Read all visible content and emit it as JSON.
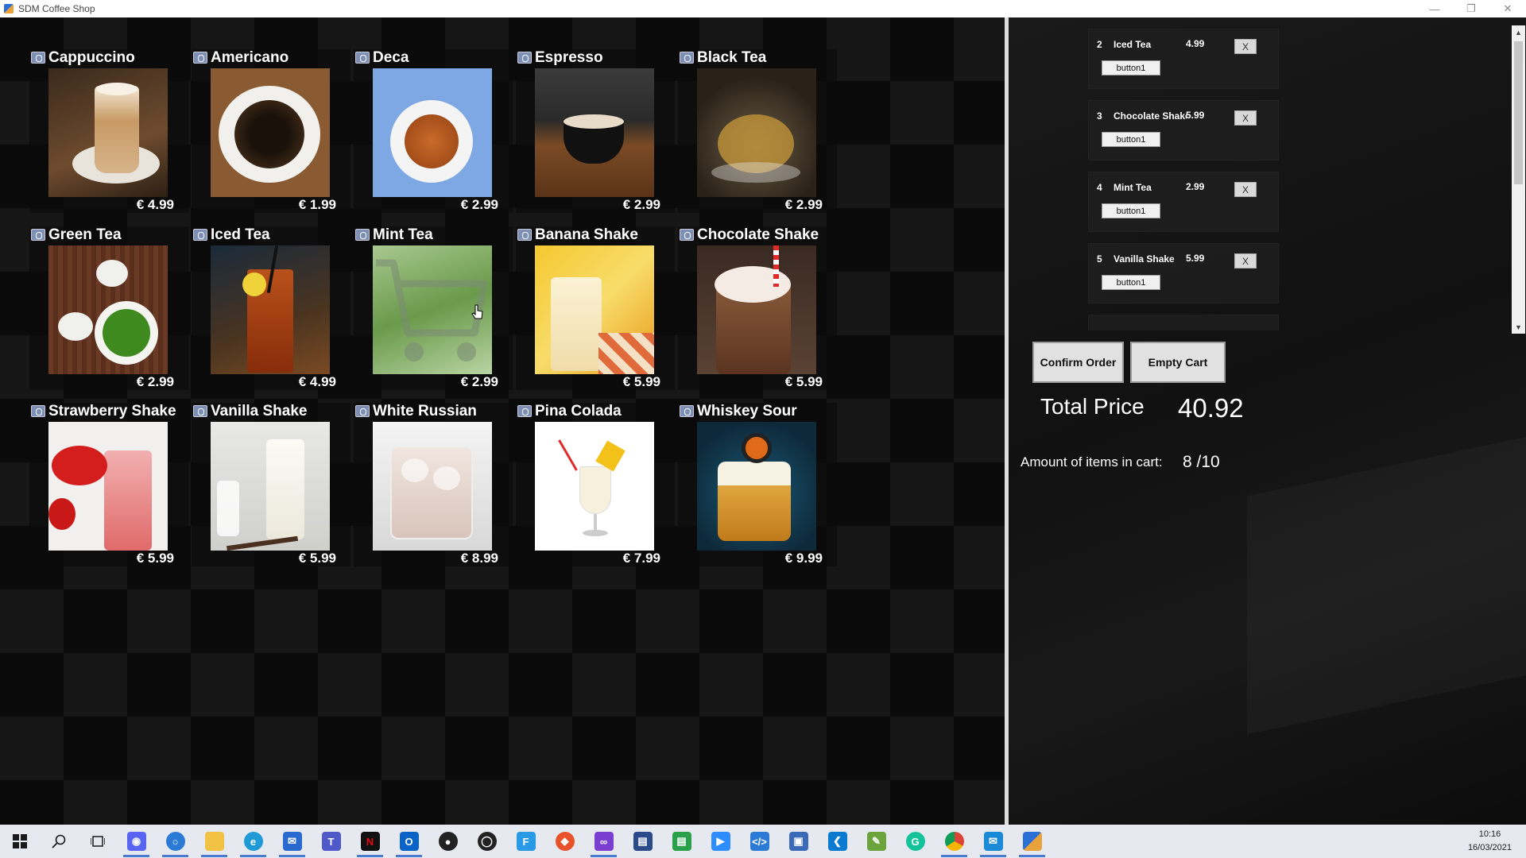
{
  "window": {
    "title": "SDM Coffee Shop"
  },
  "menu": {
    "items": [
      {
        "name": "Cappuccino",
        "price": "€ 4.99"
      },
      {
        "name": "Americano",
        "price": "€ 1.99"
      },
      {
        "name": "Deca",
        "price": "€ 2.99"
      },
      {
        "name": "Espresso",
        "price": "€ 2.99"
      },
      {
        "name": "Black Tea",
        "price": "€ 2.99"
      },
      {
        "name": "Green Tea",
        "price": "€ 2.99"
      },
      {
        "name": "Iced Tea",
        "price": "€ 4.99"
      },
      {
        "name": "Mint Tea",
        "price": "€ 2.99"
      },
      {
        "name": "Banana Shake",
        "price": "€ 5.99"
      },
      {
        "name": "Chocolate Shake",
        "price": "€ 5.99"
      },
      {
        "name": "Strawberry Shake",
        "price": "€ 5.99"
      },
      {
        "name": "Vanilla Shake",
        "price": "€ 5.99"
      },
      {
        "name": "White Russian",
        "price": "€ 8.99"
      },
      {
        "name": "Pina Colada",
        "price": "€ 7.99"
      },
      {
        "name": "Whiskey Sour",
        "price": "€ 9.99"
      }
    ]
  },
  "cart": {
    "items": [
      {
        "num": "2",
        "name": "Iced Tea",
        "price": "4.99",
        "remove": "X",
        "button": "button1"
      },
      {
        "num": "3",
        "name": "Chocolate Shake",
        "price": "5.99",
        "remove": "X",
        "button": "button1"
      },
      {
        "num": "4",
        "name": "Mint Tea",
        "price": "2.99",
        "remove": "X",
        "button": "button1"
      },
      {
        "num": "5",
        "name": "Vanilla Shake",
        "price": "5.99",
        "remove": "X",
        "button": "button1"
      }
    ],
    "confirm_label": "Confirm Order",
    "empty_label": "Empty Cart",
    "total_label": "Total Price",
    "total_value": "40.92",
    "amount_label": "Amount of items in cart:",
    "amount_value": "8  /10"
  },
  "taskbar": {
    "time": "10:16",
    "date": "16/03/2021",
    "apps": [
      "start",
      "search",
      "task-view",
      "discord",
      "app",
      "file-explorer",
      "edge",
      "mail",
      "teams",
      "netflix",
      "outlook",
      "github",
      "app",
      "app",
      "git",
      "visual-studio",
      "app",
      "app",
      "zoom",
      "app",
      "app",
      "vscode",
      "app",
      "grammarly",
      "chrome",
      "app",
      "app"
    ]
  }
}
